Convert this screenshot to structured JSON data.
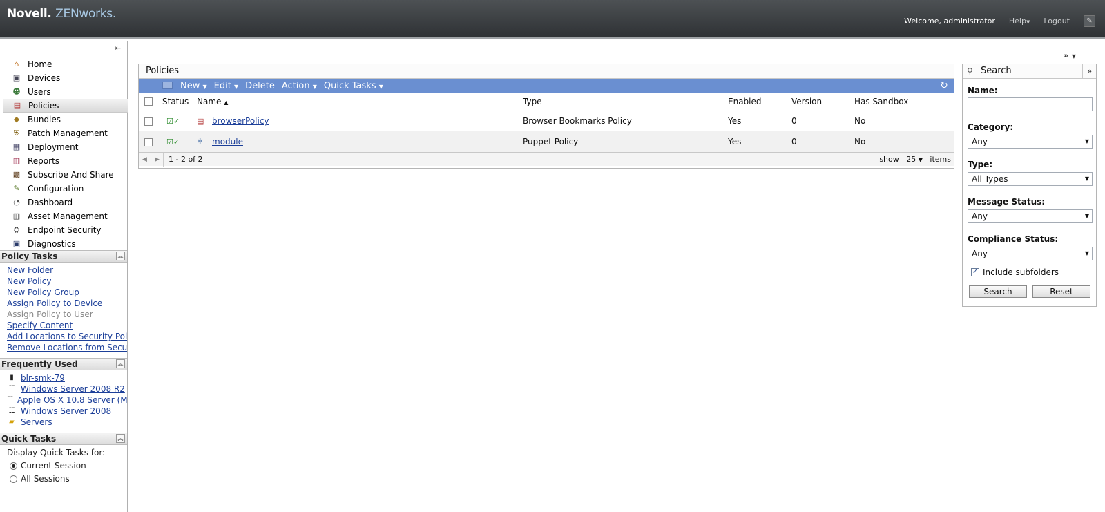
{
  "header": {
    "logo_brand": "Novell.",
    "logo_product": "ZENworks.",
    "welcome": "Welcome, administrator",
    "help_label": "Help",
    "logout_label": "Logout"
  },
  "sidebar": {
    "nav": [
      {
        "label": "Home",
        "icon": "home-icon"
      },
      {
        "label": "Devices",
        "icon": "devices-icon"
      },
      {
        "label": "Users",
        "icon": "users-icon"
      },
      {
        "label": "Policies",
        "icon": "policies-icon",
        "active": true
      },
      {
        "label": "Bundles",
        "icon": "bundles-icon"
      },
      {
        "label": "Patch Management",
        "icon": "patch-icon"
      },
      {
        "label": "Deployment",
        "icon": "deployment-icon"
      },
      {
        "label": "Reports",
        "icon": "reports-icon"
      },
      {
        "label": "Subscribe And Share",
        "icon": "subscribe-icon"
      },
      {
        "label": "Configuration",
        "icon": "configuration-icon"
      },
      {
        "label": "Dashboard",
        "icon": "dashboard-icon"
      },
      {
        "label": "Asset Management",
        "icon": "asset-icon"
      },
      {
        "label": "Endpoint Security",
        "icon": "security-icon"
      },
      {
        "label": "Diagnostics",
        "icon": "diagnostics-icon"
      }
    ],
    "policy_tasks": {
      "title": "Policy Tasks",
      "items": [
        {
          "label": "New Folder",
          "enabled": true
        },
        {
          "label": "New Policy",
          "enabled": true
        },
        {
          "label": "New Policy Group",
          "enabled": true
        },
        {
          "label": "Assign Policy to Device",
          "enabled": true
        },
        {
          "label": "Assign Policy to User",
          "enabled": false
        },
        {
          "label": "Specify Content",
          "enabled": true
        },
        {
          "label": "Add Locations to Security Poli",
          "enabled": true
        },
        {
          "label": "Remove Locations from Secur",
          "enabled": true
        }
      ]
    },
    "frequently_used": {
      "title": "Frequently Used",
      "items": [
        {
          "label": "blr-smk-79",
          "icon": "device-icon"
        },
        {
          "label": "Windows Server 2008 R2",
          "icon": "server-group-icon"
        },
        {
          "label": "Apple OS X 10.8 Server (M",
          "icon": "server-group-icon"
        },
        {
          "label": "Windows Server 2008",
          "icon": "server-group-icon"
        },
        {
          "label": "Servers",
          "icon": "folder-icon"
        }
      ]
    },
    "quick_tasks": {
      "title": "Quick Tasks",
      "display_label": "Display Quick Tasks for:",
      "options": [
        "Current Session",
        "All Sessions"
      ],
      "selected": "Current Session"
    }
  },
  "policies": {
    "title": "Policies",
    "toolbar": {
      "new": "New",
      "edit": "Edit",
      "delete": "Delete",
      "action": "Action",
      "quick_tasks": "Quick Tasks"
    },
    "columns": [
      "Status",
      "Name",
      "Type",
      "Enabled",
      "Version",
      "Has Sandbox"
    ],
    "rows": [
      {
        "name": "browserPolicy",
        "type": "Browser Bookmarks Policy",
        "enabled": "Yes",
        "version": "0",
        "sandbox": "No"
      },
      {
        "name": "module",
        "type": "Puppet Policy",
        "enabled": "Yes",
        "version": "0",
        "sandbox": "No"
      }
    ],
    "pager": {
      "range": "1 - 2 of 2",
      "show": "show",
      "count": "25",
      "items": "items"
    }
  },
  "search": {
    "title": "Search",
    "name_label": "Name:",
    "name_value": "",
    "category_label": "Category:",
    "category_value": "Any",
    "type_label": "Type:",
    "type_value": "All Types",
    "message_status_label": "Message Status:",
    "message_status_value": "Any",
    "compliance_status_label": "Compliance Status:",
    "compliance_status_value": "Any",
    "include_subfolders_label": "Include subfolders",
    "include_subfolders_checked": true,
    "search_button": "Search",
    "reset_button": "Reset"
  }
}
